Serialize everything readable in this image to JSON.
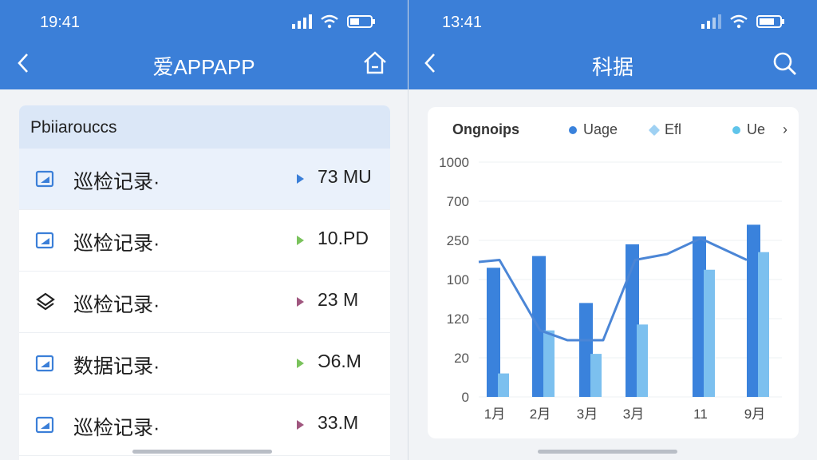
{
  "left": {
    "status_time": "19:41",
    "nav_title": "爱APPAPP",
    "panel_header": "Pbiiaroucсs",
    "rows": [
      {
        "label": "巡检记录·",
        "value": "73 MU",
        "tri_color": "#3b7fd8",
        "icon": "image-icon"
      },
      {
        "label": "巡检记录·",
        "value": "10.PD",
        "tri_color": "#7ac25c",
        "icon": "image-icon"
      },
      {
        "label": "巡检记录·",
        "value": "23 M",
        "tri_color": "#a0577f",
        "icon": "layers-icon"
      },
      {
        "label": "数据记录·",
        "value": "Ͻ6.M",
        "tri_color": "#7ac25c",
        "icon": "image-icon"
      },
      {
        "label": "巡检记录·",
        "value": "33.M",
        "tri_color": "#a0577f",
        "icon": "image-icon"
      }
    ]
  },
  "right": {
    "status_time": "13:41",
    "nav_title": "科据",
    "chart_data": {
      "type": "bar",
      "legend_title": "Ongnoips",
      "legend_more": "›",
      "categories": [
        "1月",
        "2月",
        "3月",
        "3月",
        "11",
        "9月"
      ],
      "y_tick_labels": [
        "0",
        "20",
        "120",
        "100",
        "250",
        "700",
        "1000"
      ],
      "series": [
        {
          "name": "Uage",
          "type": "bar",
          "color": "#3a82dc",
          "values": [
            3.3,
            3.6,
            2.4,
            3.9,
            4.1,
            4.4
          ]
        },
        {
          "name": "Efl",
          "type": "bar",
          "color": "#7cc0ef",
          "values": [
            0.6,
            1.7,
            1.1,
            1.85,
            3.25,
            3.7
          ]
        },
        {
          "name": "Ue",
          "type": "line",
          "color": "#4b86d6",
          "values": [
            3.5,
            1.7,
            1.45,
            3.5,
            4.05,
            3.5
          ]
        }
      ],
      "grid": true,
      "legend_position": "top"
    }
  },
  "colors": {
    "accent": "#3b7fd8"
  }
}
